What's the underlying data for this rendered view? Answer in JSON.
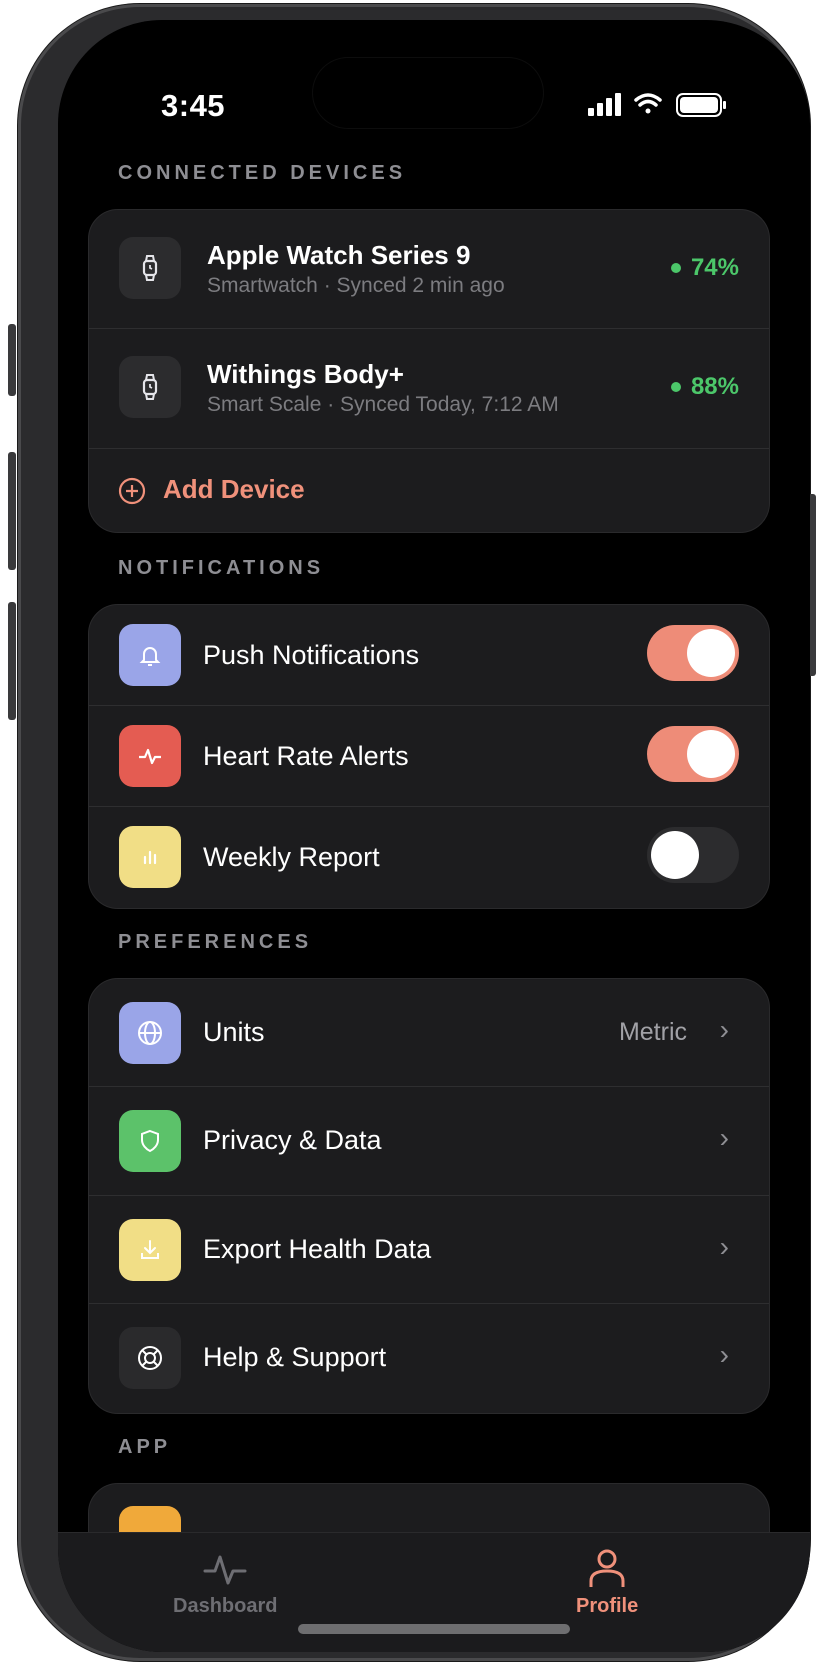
{
  "status_bar": {
    "time": "3:45"
  },
  "sections": {
    "devices_label": "CONNECTED DEVICES",
    "notifications_label": "NOTIFICATIONS",
    "preferences_label": "PREFERENCES",
    "app_label": "APP"
  },
  "devices": [
    {
      "name": "Apple Watch Series 9",
      "subtitle": "Smartwatch · Synced 2 min ago",
      "battery": "74%",
      "icon": "watch-icon"
    },
    {
      "name": "Withings Body+",
      "subtitle": "Smart Scale · Synced Today, 7:12 AM",
      "battery": "88%",
      "icon": "watch-icon"
    }
  ],
  "add_device": {
    "label": "Add Device",
    "icon": "plus-circle-icon"
  },
  "notifications": [
    {
      "label": "Push Notifications",
      "icon": "bell-icon",
      "color": "#9aa5e8",
      "enabled": true
    },
    {
      "label": "Heart Rate Alerts",
      "icon": "heart-pulse-icon",
      "color": "#e45c52",
      "enabled": true
    },
    {
      "label": "Weekly Report",
      "icon": "bar-chart-icon",
      "color": "#f1de86",
      "enabled": false
    }
  ],
  "preferences": [
    {
      "label": "Units",
      "value": "Metric",
      "icon": "globe-icon",
      "color": "#9aa5e8"
    },
    {
      "label": "Privacy & Data",
      "value": "",
      "icon": "shield-icon",
      "color": "#5cc26a"
    },
    {
      "label": "Export Health Data",
      "value": "",
      "icon": "download-icon",
      "color": "#f1de86"
    },
    {
      "label": "Help & Support",
      "value": "",
      "icon": "lifebuoy-icon",
      "color": "#2a2a2c"
    }
  ],
  "tabs": [
    {
      "label": "Dashboard",
      "icon": "activity-icon",
      "active": false
    },
    {
      "label": "Profile",
      "icon": "person-icon",
      "active": true
    }
  ],
  "colors": {
    "accent": "#f0917b",
    "battery_green": "#4cc76a",
    "toggle_on": "#ee8c78",
    "toggle_off": "#2c2c2e"
  }
}
